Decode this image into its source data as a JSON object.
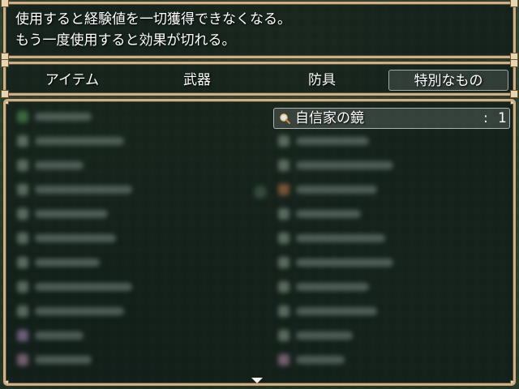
{
  "help": {
    "line1": "使用すると経験値を一切獲得できなくなる。",
    "line2": "もう一度使用すると効果が切れる。"
  },
  "tabs": [
    {
      "label": "アイテム",
      "selected": false
    },
    {
      "label": "武器",
      "selected": false
    },
    {
      "label": "防具",
      "selected": false
    },
    {
      "label": "特別なもの",
      "selected": true
    }
  ],
  "selected_item": {
    "name": "自信家の鏡",
    "colon": ":",
    "count": "1",
    "icon": "magnifier-icon"
  },
  "colors": {
    "frame": "#c9b18a",
    "window_bg": "#0e1816",
    "text": "#ffffff"
  }
}
